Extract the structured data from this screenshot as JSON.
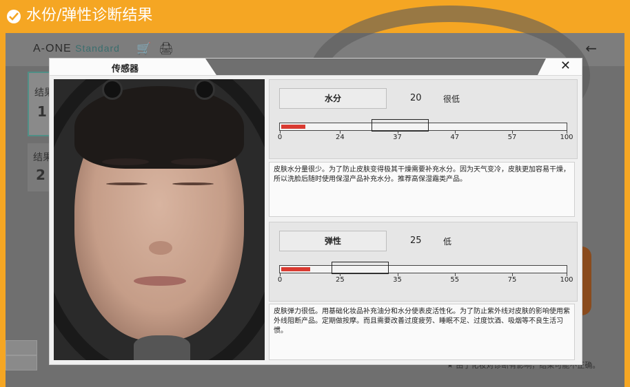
{
  "header": {
    "title": "水份/弹性诊断结果"
  },
  "background": {
    "brand": "A-ONE",
    "brand_sub": "Standard",
    "panel1_label": "结果",
    "panel1_value": "1",
    "panel2_label": "结果",
    "panel2_value": "2",
    "note": "★ 由于化妆对诊断有影响，结果可能不正确。",
    "cart_icon": "cart-icon",
    "print_icon": "printer-icon",
    "back_icon": "back-arrow-icon"
  },
  "dialog": {
    "tab_label": "传感器",
    "close_glyph": "✕"
  },
  "metrics": [
    {
      "name": "水分",
      "value": "20",
      "level": "很低",
      "fill_percent": 8.5,
      "range_min": 32,
      "range_max": 52,
      "ticks": [
        "0",
        "24",
        "37",
        "47",
        "57",
        "100"
      ],
      "tick_positions_percent": [
        0,
        21,
        41,
        61,
        81,
        100
      ],
      "description": "皮肤水分量很少。为了防止皮肤变得极其干燥需要补充水分。因为天气变冷，皮肤更加容易干燥，所以洗脸后随时使用保湿产品补充水分。推荐高保湿霜类产品。"
    },
    {
      "name": "弹性",
      "value": "25",
      "level": "低",
      "fill_percent": 10,
      "range_min": 18,
      "range_max": 38,
      "ticks": [
        "0",
        "25",
        "35",
        "55",
        "75",
        "100"
      ],
      "tick_positions_percent": [
        0,
        21,
        41,
        61,
        81,
        100
      ],
      "description": "皮肤弹力很低。用基础化妆品补充油分和水分使表皮活性化。为了防止紫外线对皮肤的影响使用紫外线阻断产品。定期做按摩。而且需要改善过度疲劳、睡眠不足、过度饮酒、吸烟等不良生活习惯。"
    }
  ],
  "colors": {
    "accent": "#f5a623",
    "bar_fill": "#d93a31"
  }
}
